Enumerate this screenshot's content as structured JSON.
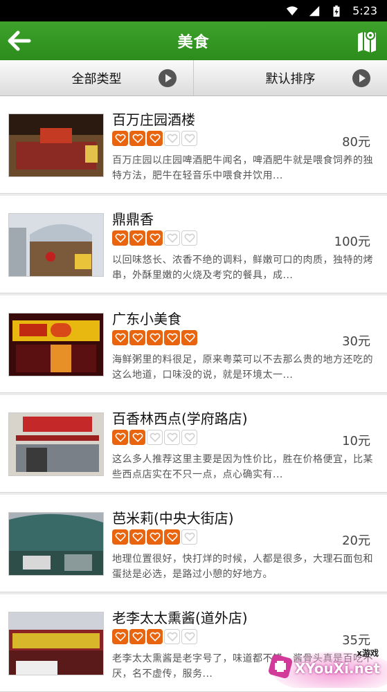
{
  "status_bar": {
    "time": "5:23"
  },
  "header": {
    "title": "美食"
  },
  "filters": [
    {
      "label": "全部类型"
    },
    {
      "label": "默认排序"
    }
  ],
  "restaurants": [
    {
      "name": "百万庄园酒楼",
      "rating": 3,
      "price": "80元",
      "description": "百万庄园以庄园啤酒肥牛闻名，啤酒肥牛就是喂食饲养的独特方法，肥牛在轻音乐中喂食并饮用..."
    },
    {
      "name": "鼎鼎香",
      "rating": 3,
      "price": "100元",
      "description": "以回味悠长、浓香不绝的调料，鲜嫩可口的肉质，独特的烤串，外酥里嫩的火烧及考究的餐具，成..."
    },
    {
      "name": "广东小美食",
      "rating": 5,
      "price": "30元",
      "description": "海鲜粥里的料很足，原来粤菜可以不去那么贵的地方还吃的这么地道，口味没的说，就是环境太一..."
    },
    {
      "name": "百香林西点(学府路店)",
      "rating": 2,
      "price": "10元",
      "description": "这么多人推荐这里主要是因为性价比，胜在价格便宜，比某些西点店实在不只一点，点心确实有..."
    },
    {
      "name": "芭米莉(中央大街店)",
      "rating": 4,
      "price": "20元",
      "description": "地理位置很好，快打烊的时候，人都是很多，大理石面包和蛋挞是必选，是路过小憩的好地方。"
    },
    {
      "name": "老李太太熏酱(道外店)",
      "rating": 3,
      "price": "35元",
      "description": "老李太太熏酱是老字号了，味道都不错，酱骨头真是百吃不厌，名不虚传，服务..."
    }
  ],
  "watermark": {
    "site": "XYouXi.net",
    "tag": "x游戏"
  },
  "colors": {
    "header_green": "#2e8f1e",
    "star_orange": "#e8640f"
  }
}
